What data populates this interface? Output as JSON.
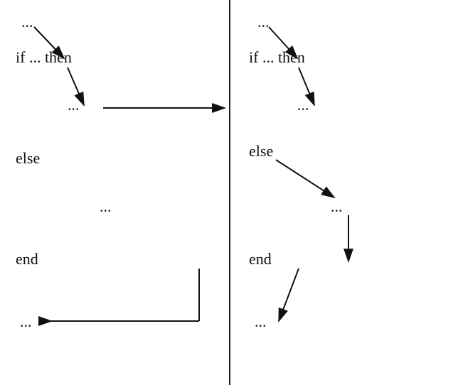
{
  "left": {
    "ellipsis_top": "...",
    "if_then": "if ... then",
    "ellipsis_mid": "...",
    "else": "else",
    "ellipsis_else": "...",
    "end": "end",
    "ellipsis_bottom": "..."
  },
  "right": {
    "ellipsis_top": "...",
    "if_then": "if ... then",
    "ellipsis_mid": "...",
    "else": "else",
    "ellipsis_else": "...",
    "end": "end",
    "ellipsis_bottom": "..."
  }
}
